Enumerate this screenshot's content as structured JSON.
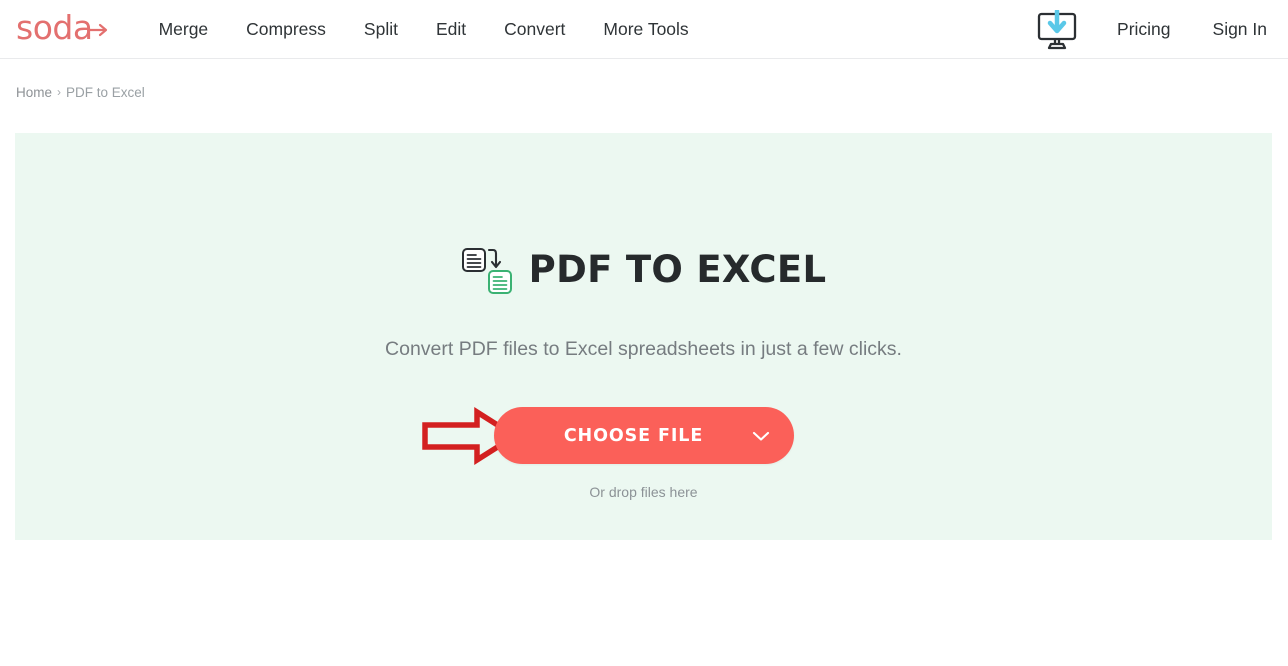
{
  "header": {
    "logo": {
      "text": "soda",
      "icon": "arrow-right-icon",
      "color": "#e3706f"
    },
    "nav": [
      {
        "label": "Merge",
        "name": "nav-item-merge"
      },
      {
        "label": "Compress",
        "name": "nav-item-compress"
      },
      {
        "label": "Split",
        "name": "nav-item-split"
      },
      {
        "label": "Edit",
        "name": "nav-item-edit"
      },
      {
        "label": "Convert",
        "name": "nav-item-convert"
      },
      {
        "label": "More Tools",
        "name": "nav-item-more-tools"
      }
    ],
    "desktop_app_icon": "desktop-download-icon",
    "pricing_label": "Pricing",
    "signin_label": "Sign In"
  },
  "breadcrumb": {
    "home_label": "Home",
    "separator": "›",
    "current_label": "PDF to Excel"
  },
  "main": {
    "panel_background": "#ecf8f1",
    "title_icon": "pdf-to-excel-convert-icon",
    "title": "PDF TO EXCEL",
    "subtitle": "Convert PDF files to Excel spreadsheets in just a few clicks.",
    "choose_file_label": "CHOOSE FILE",
    "choose_file_chevron": "chevron-down-icon",
    "choose_file_color": "#fb6059",
    "drop_hint": "Or drop files here",
    "annotation": {
      "icon": "red-pointer-arrow-icon",
      "color": "#d32020"
    }
  }
}
